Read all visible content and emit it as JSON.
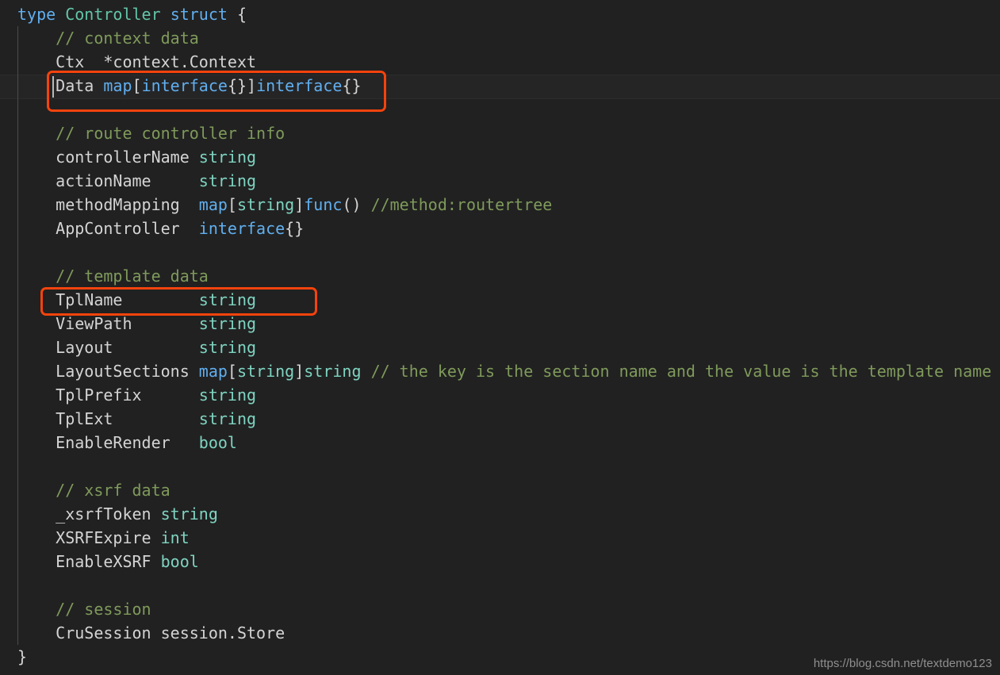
{
  "editor": {
    "language": "go",
    "background_color": "#212121",
    "default_text_color": "#d4d4d4",
    "font_size_px": 20,
    "line_height_px": 30,
    "colors": {
      "keyword": "#61afef",
      "type": "#7fd4c1",
      "identifier": "#d4d4d4",
      "punctuation": "#d4d4d4",
      "comment": "#7f9a5b",
      "class_name": "#63c5a8",
      "current_line": "#252526",
      "indent_guide": "#4b4b4b",
      "caret": "#b8b8b8",
      "annotation_red": "#f4430d"
    },
    "lines": [
      {
        "n": 1,
        "indent": 0,
        "tokens": [
          {
            "t": "type",
            "c": "key"
          },
          {
            "t": " ",
            "c": "punct"
          },
          {
            "t": "Controller",
            "c": "classname"
          },
          {
            "t": " ",
            "c": "punct"
          },
          {
            "t": "struct",
            "c": "key"
          },
          {
            "t": " {",
            "c": "punct"
          }
        ]
      },
      {
        "n": 2,
        "indent": 1,
        "tokens": [
          {
            "t": "// context data",
            "c": "comment"
          }
        ]
      },
      {
        "n": 3,
        "indent": 1,
        "tokens": [
          {
            "t": "Ctx  *context.Context",
            "c": "ident"
          }
        ]
      },
      {
        "n": 4,
        "indent": 1,
        "tokens": [
          {
            "t": "Data ",
            "c": "ident"
          },
          {
            "t": "map",
            "c": "key"
          },
          {
            "t": "[",
            "c": "punct"
          },
          {
            "t": "interface",
            "c": "key"
          },
          {
            "t": "{}]",
            "c": "punct"
          },
          {
            "t": "interface",
            "c": "key"
          },
          {
            "t": "{}",
            "c": "punct"
          }
        ]
      },
      {
        "n": 5,
        "indent": 1,
        "tokens": []
      },
      {
        "n": 6,
        "indent": 1,
        "tokens": [
          {
            "t": "// route controller info",
            "c": "comment"
          }
        ]
      },
      {
        "n": 7,
        "indent": 1,
        "tokens": [
          {
            "t": "controllerName ",
            "c": "ident"
          },
          {
            "t": "string",
            "c": "type"
          }
        ]
      },
      {
        "n": 8,
        "indent": 1,
        "tokens": [
          {
            "t": "actionName     ",
            "c": "ident"
          },
          {
            "t": "string",
            "c": "type"
          }
        ]
      },
      {
        "n": 9,
        "indent": 1,
        "tokens": [
          {
            "t": "methodMapping  ",
            "c": "ident"
          },
          {
            "t": "map",
            "c": "key"
          },
          {
            "t": "[",
            "c": "punct"
          },
          {
            "t": "string",
            "c": "type"
          },
          {
            "t": "]",
            "c": "punct"
          },
          {
            "t": "func",
            "c": "key"
          },
          {
            "t": "() ",
            "c": "punct"
          },
          {
            "t": "//method:routertree",
            "c": "comment"
          }
        ]
      },
      {
        "n": 10,
        "indent": 1,
        "tokens": [
          {
            "t": "AppController  ",
            "c": "ident"
          },
          {
            "t": "interface",
            "c": "key"
          },
          {
            "t": "{}",
            "c": "punct"
          }
        ]
      },
      {
        "n": 11,
        "indent": 1,
        "tokens": []
      },
      {
        "n": 12,
        "indent": 1,
        "tokens": [
          {
            "t": "// template data",
            "c": "comment"
          }
        ]
      },
      {
        "n": 13,
        "indent": 1,
        "tokens": [
          {
            "t": "TplName        ",
            "c": "ident"
          },
          {
            "t": "string",
            "c": "type"
          }
        ]
      },
      {
        "n": 14,
        "indent": 1,
        "tokens": [
          {
            "t": "ViewPath       ",
            "c": "ident"
          },
          {
            "t": "string",
            "c": "type"
          }
        ]
      },
      {
        "n": 15,
        "indent": 1,
        "tokens": [
          {
            "t": "Layout         ",
            "c": "ident"
          },
          {
            "t": "string",
            "c": "type"
          }
        ]
      },
      {
        "n": 16,
        "indent": 1,
        "tokens": [
          {
            "t": "LayoutSections ",
            "c": "ident"
          },
          {
            "t": "map",
            "c": "key"
          },
          {
            "t": "[",
            "c": "punct"
          },
          {
            "t": "string",
            "c": "type"
          },
          {
            "t": "]",
            "c": "punct"
          },
          {
            "t": "string",
            "c": "type"
          },
          {
            "t": " ",
            "c": "punct"
          },
          {
            "t": "// the key is the section name and the value is the template name",
            "c": "comment"
          }
        ]
      },
      {
        "n": 17,
        "indent": 1,
        "tokens": [
          {
            "t": "TplPrefix      ",
            "c": "ident"
          },
          {
            "t": "string",
            "c": "type"
          }
        ]
      },
      {
        "n": 18,
        "indent": 1,
        "tokens": [
          {
            "t": "TplExt         ",
            "c": "ident"
          },
          {
            "t": "string",
            "c": "type"
          }
        ]
      },
      {
        "n": 19,
        "indent": 1,
        "tokens": [
          {
            "t": "EnableRender   ",
            "c": "ident"
          },
          {
            "t": "bool",
            "c": "type"
          }
        ]
      },
      {
        "n": 20,
        "indent": 1,
        "tokens": []
      },
      {
        "n": 21,
        "indent": 1,
        "tokens": [
          {
            "t": "// xsrf data",
            "c": "comment"
          }
        ]
      },
      {
        "n": 22,
        "indent": 1,
        "tokens": [
          {
            "t": "_xsrfToken ",
            "c": "ident"
          },
          {
            "t": "string",
            "c": "type"
          }
        ]
      },
      {
        "n": 23,
        "indent": 1,
        "tokens": [
          {
            "t": "XSRFExpire ",
            "c": "ident"
          },
          {
            "t": "int",
            "c": "type"
          }
        ]
      },
      {
        "n": 24,
        "indent": 1,
        "tokens": [
          {
            "t": "EnableXSRF ",
            "c": "ident"
          },
          {
            "t": "bool",
            "c": "type"
          }
        ]
      },
      {
        "n": 25,
        "indent": 1,
        "tokens": []
      },
      {
        "n": 26,
        "indent": 1,
        "tokens": [
          {
            "t": "// session",
            "c": "comment"
          }
        ]
      },
      {
        "n": 27,
        "indent": 1,
        "tokens": [
          {
            "t": "CruSession session.Store",
            "c": "ident"
          }
        ]
      },
      {
        "n": 28,
        "indent": 0,
        "tokens": [
          {
            "t": "}",
            "c": "punct"
          }
        ]
      }
    ]
  },
  "annotations": [
    {
      "id": "annot-box-data",
      "label": "Data map[interface{}]interface{}",
      "shape": "rectangle",
      "color": "#f4430d"
    },
    {
      "id": "annot-box-tplname",
      "label": "TplName        string",
      "shape": "rectangle",
      "color": "#f4430d"
    }
  ],
  "watermark": {
    "text": "https://blog.csdn.net/textdemo123"
  }
}
